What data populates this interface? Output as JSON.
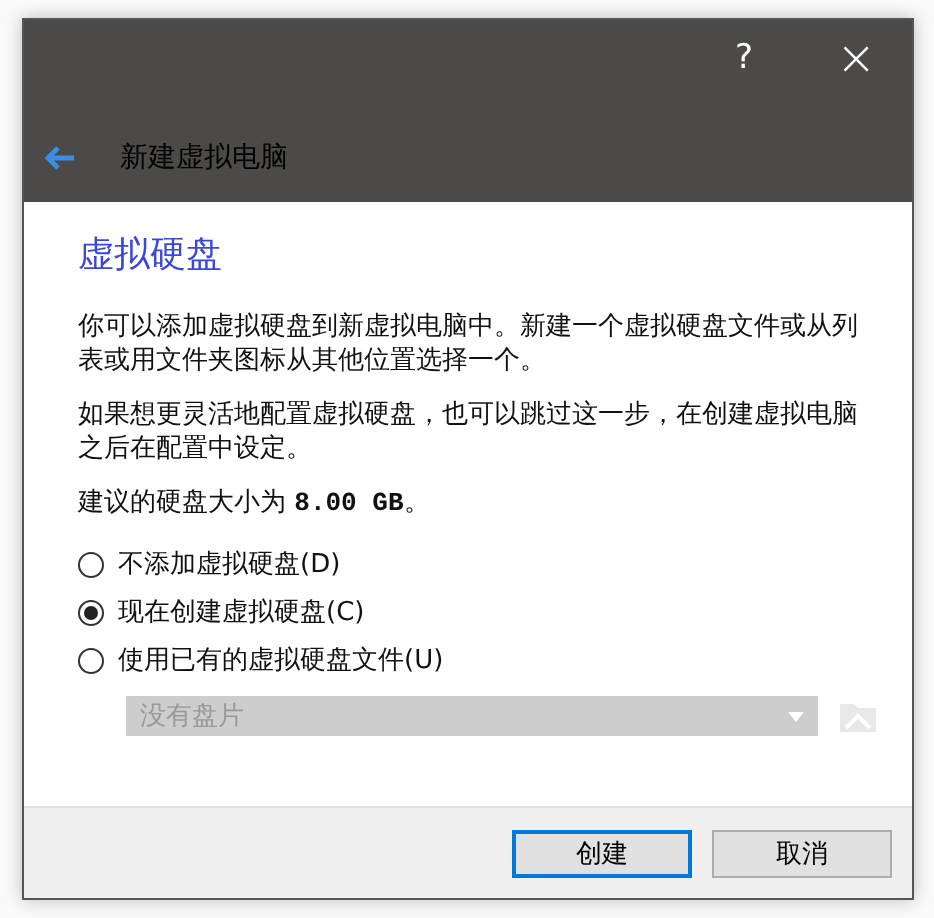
{
  "window": {
    "title": "新建虚拟电脑",
    "help": "?",
    "close": "×"
  },
  "page": {
    "heading": "虚拟硬盘",
    "paragraphs": [
      "你可以添加虚拟硬盘到新虚拟电脑中。新建一个虚拟硬盘文件或从列表或用文件夹图标从其他位置选择一个。",
      "如果想更灵活地配置虚拟硬盘，也可以跳过这一步，在创建虚拟电脑之后在配置中设定。",
      "建议的硬盘大小为 **8.00 GB**。"
    ],
    "options": [
      {
        "label": "不添加虚拟硬盘(D)",
        "selected": false
      },
      {
        "label": "现在创建虚拟硬盘(C)",
        "selected": true
      },
      {
        "label": "使用已有的虚拟硬盘文件(U)",
        "selected": false
      }
    ],
    "disk_select": {
      "value": "没有盘片",
      "disabled": true
    }
  },
  "buttons": [
    {
      "label": "创建",
      "default": true
    },
    {
      "label": "取消",
      "default": false
    }
  ]
}
